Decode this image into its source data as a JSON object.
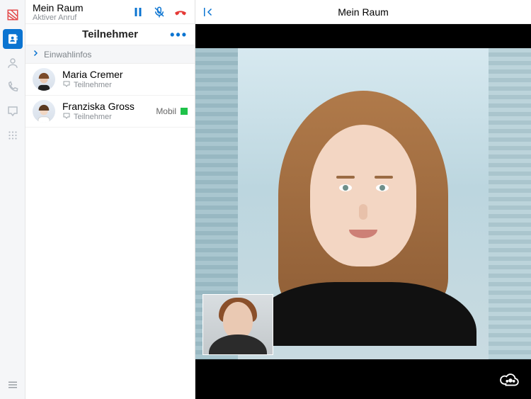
{
  "call": {
    "room_name": "Mein Raum",
    "status": "Aktiver Anruf"
  },
  "panel": {
    "title": "Teilnehmer",
    "dialin_label": "Einwahlinfos"
  },
  "participants": [
    {
      "name": "Maria Cremer",
      "role": "Teilnehmer",
      "device": "",
      "online": false
    },
    {
      "name": "Franziska Gross",
      "role": "Teilnehmer",
      "device": "Mobil",
      "online": true
    }
  ],
  "main": {
    "title": "Mein Raum"
  },
  "icons": {
    "logo": "logo",
    "contacts": "contacts",
    "profile": "profile",
    "calls": "calls",
    "chat": "chat",
    "dialpad": "dialpad",
    "menu": "menu",
    "pause": "pause",
    "mic_muted": "mic-muted",
    "hangup": "hangup",
    "collapse": "collapse",
    "more": "more",
    "chat_bubble": "chat-bubble",
    "cloud_view": "cloud-view"
  }
}
